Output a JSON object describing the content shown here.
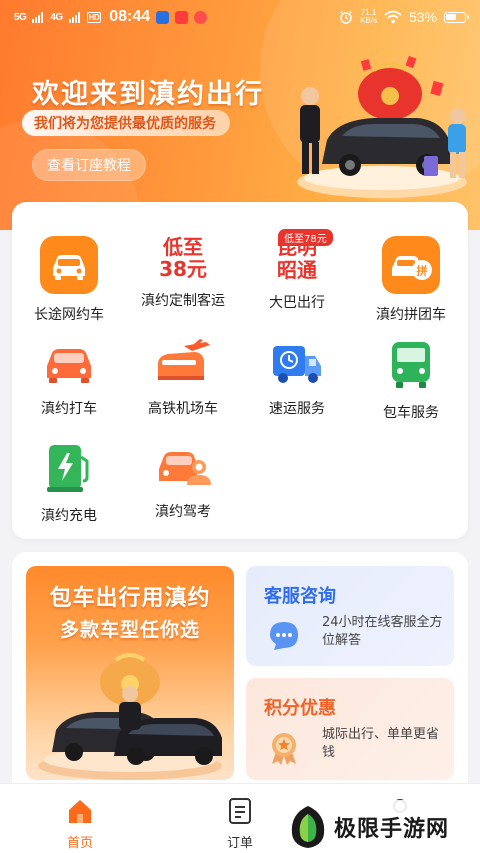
{
  "status_bar": {
    "signal1": "5G",
    "signal2": "4G",
    "hd": "HD",
    "time": "08:44",
    "net_speed_value": "71.1",
    "net_speed_unit": "KB/s",
    "battery": "53%"
  },
  "hero": {
    "title": "欢迎来到滇约出行",
    "subtitle": "我们将为您提供最优质的服务",
    "tutorial_button": "查看订座教程"
  },
  "services": [
    {
      "label": "长途网约车",
      "icon": "car-icon"
    },
    {
      "label": "滇约定制客运",
      "icon": "price-text-icon",
      "icon_text_1": "低至",
      "icon_text_2": "38元"
    },
    {
      "label": "大巴出行",
      "icon": "route-text-icon",
      "icon_text_1": "昆明",
      "icon_text_2": "昭通",
      "badge": "低至78元"
    },
    {
      "label": "滇约拼团车",
      "icon": "carpool-icon",
      "icon_text_1": "拼"
    },
    {
      "label": "滇约打车",
      "icon": "taxi-icon"
    },
    {
      "label": "高铁机场车",
      "icon": "train-plane-icon"
    },
    {
      "label": "速运服务",
      "icon": "delivery-truck-icon"
    },
    {
      "label": "包车服务",
      "icon": "bus-icon"
    },
    {
      "label": "滇约充电",
      "icon": "charging-station-icon"
    },
    {
      "label": "滇约驾考",
      "icon": "driving-test-icon"
    }
  ],
  "promo": {
    "charter_title": "包车出行用滇约",
    "charter_subtitle": "多款车型任你选",
    "customer_service": {
      "title": "客服咨询",
      "desc": "24小时在线客服全方位解答"
    },
    "points": {
      "title": "积分优惠",
      "desc": "城际出行、单单更省钱"
    }
  },
  "tabbar": {
    "home": "首页",
    "orders": "订单"
  },
  "watermark": {
    "text": "极限手游网"
  },
  "colors": {
    "brand_orange": "#ff6a1a",
    "service_blue": "#2f6df0",
    "points_orange": "#f0642a",
    "badge_red": "#e8342c"
  }
}
